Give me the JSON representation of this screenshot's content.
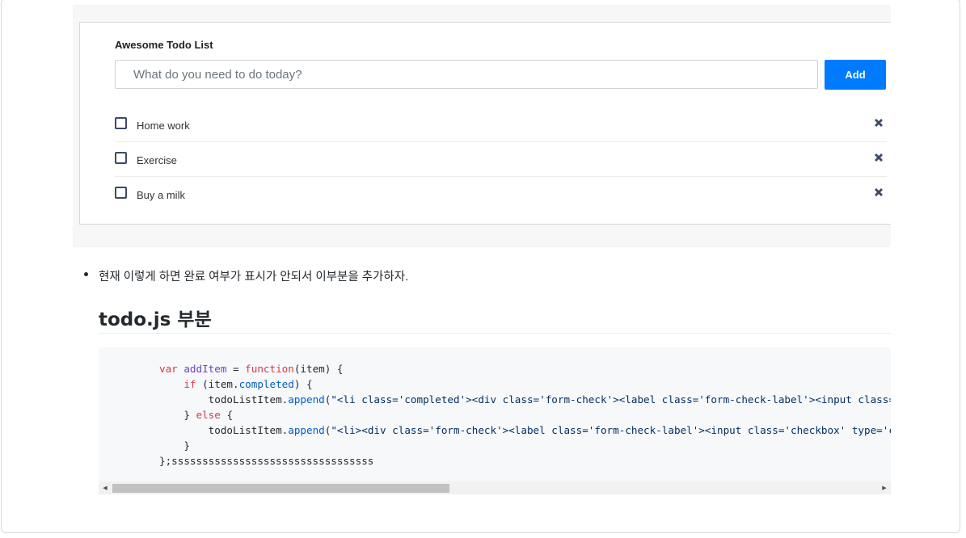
{
  "todo": {
    "title": "Awesome Todo List",
    "input_placeholder": "What do you need to do today?",
    "add_label": "Add",
    "items": [
      {
        "label": "Home work"
      },
      {
        "label": "Exercise"
      },
      {
        "label": "Buy a milk"
      }
    ]
  },
  "post": {
    "bullet": "현재 이렇게 하면 완료 여부가 표시가 안되서 이부분을 추가하자.",
    "heading": "todo.js 부분",
    "code": {
      "l1_var": "var",
      "l1_name": "addItem",
      "l1_eq": " = ",
      "l1_func": "function",
      "l1_rest": "(item) {",
      "l2_if": "if",
      "l2_open": " (item.",
      "l2_prop": "completed",
      "l2_close": ") {",
      "l3_obj": "todoListItem.",
      "l3_fn": "append",
      "l3_paren": "(",
      "l3_str": "\"<li class='completed'><div class='form-check'><label class='form-check-label'><input class='checkbox' type='checkbox' checked='checked'/>\"",
      "l4_close": "} ",
      "l4_else": "else",
      "l4_open": " {",
      "l5_obj": "todoListItem.",
      "l5_fn": "append",
      "l5_paren": "(",
      "l5_str": "\"<li><div class='form-check'><label class='form-check-label'><input class='checkbox' type='checkbox'/>\"",
      "l6": "}",
      "l7": "};sssssssssssssssssssssssssssssssss"
    }
  },
  "colors": {
    "primary": "#007bff",
    "check_border": "#3d4a66",
    "keyword": "#d73a49",
    "function": "#6f42c1",
    "property": "#005cc5"
  },
  "icons": {
    "remove": "remove-x-icon",
    "scroll_left": "scroll-left-arrow-icon",
    "scroll_right": "scroll-right-arrow-icon"
  }
}
